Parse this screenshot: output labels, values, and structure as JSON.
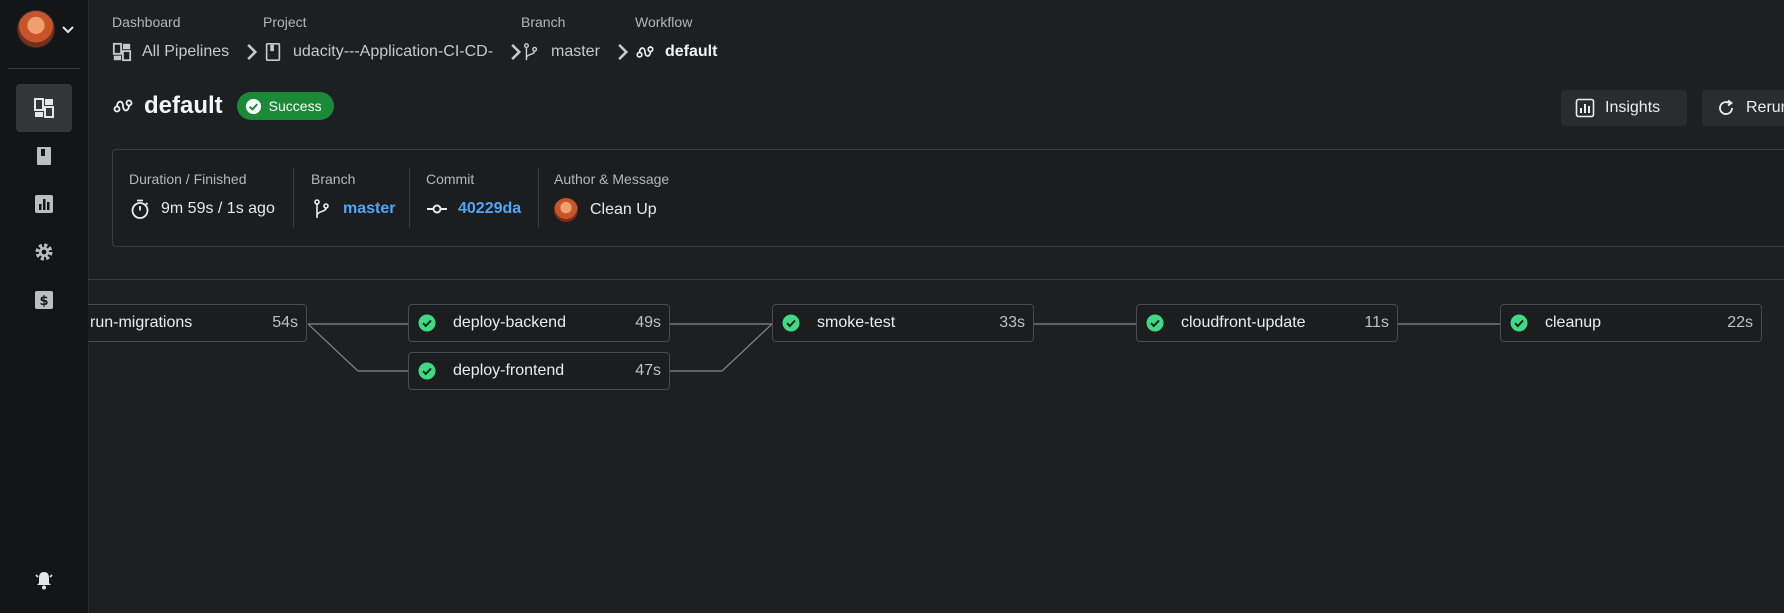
{
  "sidebar": {
    "items": [
      {
        "icon": "dashboard-icon",
        "active": true
      },
      {
        "icon": "project-book-icon",
        "active": false
      },
      {
        "icon": "insights-chart-icon",
        "active": false
      },
      {
        "icon": "settings-gear-icon",
        "active": false
      },
      {
        "icon": "billing-dollar-icon",
        "active": false
      }
    ],
    "bell_icon": "notification-bell-icon"
  },
  "breadcrumbs": [
    {
      "label": "Dashboard",
      "value": "All Pipelines",
      "icon": "dashboard-icon"
    },
    {
      "label": "Project",
      "value": "udacity---Application-CI-CD-",
      "icon": "project-book-icon"
    },
    {
      "label": "Branch",
      "value": "master",
      "icon": "branch-icon"
    },
    {
      "label": "Workflow",
      "value": "default",
      "icon": "workflow-icon"
    }
  ],
  "header": {
    "title": "default",
    "status": "Success",
    "insights_label": "Insights",
    "rerun_label": "Rerun"
  },
  "info": {
    "duration_label": "Duration / Finished",
    "duration_value": "9m 59s / 1s ago",
    "branch_label": "Branch",
    "branch_value": "master",
    "commit_label": "Commit",
    "commit_value": "40229da",
    "author_label": "Author & Message",
    "message": "Clean Up"
  },
  "jobs": [
    {
      "name": "run-migrations",
      "duration": "54s",
      "status": "success"
    },
    {
      "name": "deploy-backend",
      "duration": "49s",
      "status": "success"
    },
    {
      "name": "deploy-frontend",
      "duration": "47s",
      "status": "success"
    },
    {
      "name": "smoke-test",
      "duration": "33s",
      "status": "success"
    },
    {
      "name": "cloudfront-update",
      "duration": "11s",
      "status": "success"
    },
    {
      "name": "cleanup",
      "duration": "22s",
      "status": "success"
    }
  ],
  "colors": {
    "success": "#1a8a36",
    "check": "#3ddc84",
    "link": "#4ea8f7",
    "background": "#1e1f21"
  }
}
